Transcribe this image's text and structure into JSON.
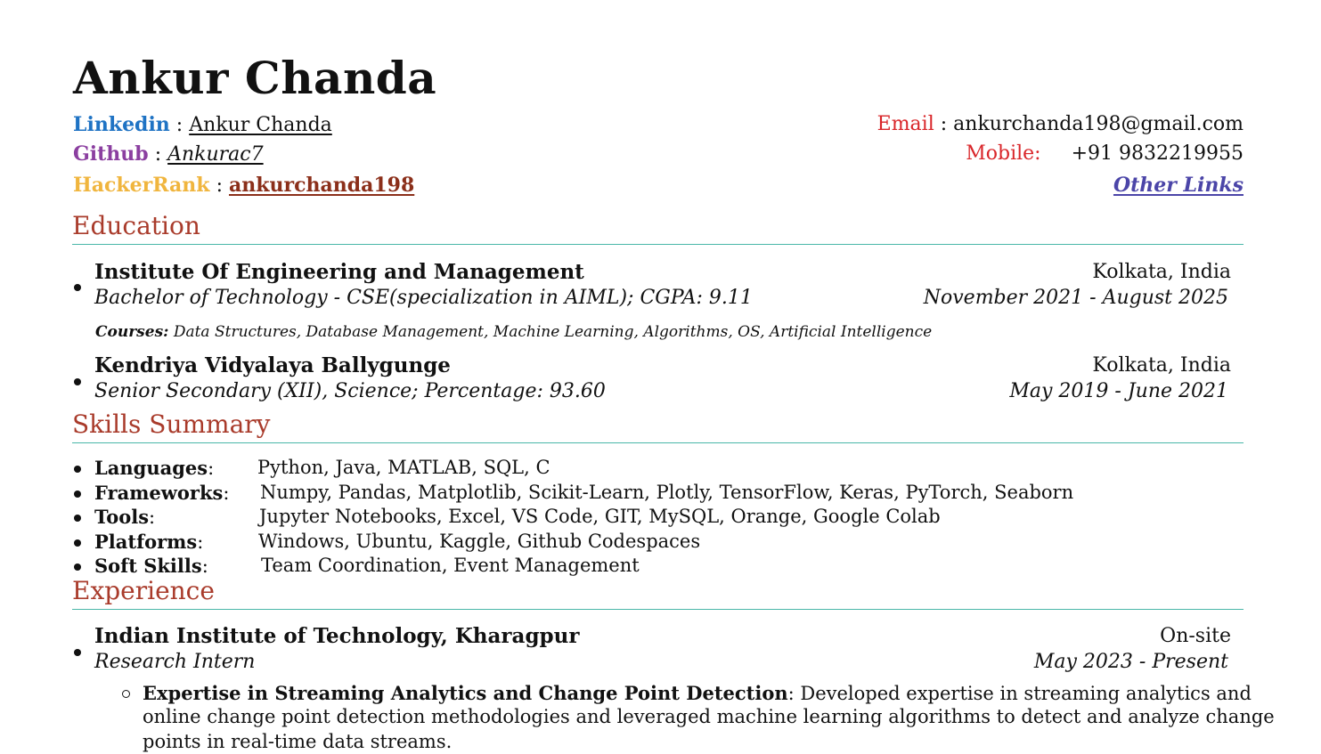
{
  "header": {
    "name": "Ankur Chanda",
    "linkedin_label": "Linkedin",
    "linkedin_value": "Ankur Chanda",
    "github_label": "Github",
    "github_value": "Ankurac7",
    "hackerrank_label": "HackerRank",
    "hackerrank_value": "ankurchanda198",
    "email_label": "Email",
    "email_value": "ankurchanda198@gmail.com",
    "mobile_label": "Mobile:",
    "mobile_value": "+91 9832219955",
    "other_links": "Other Links",
    "sep": ":"
  },
  "education": {
    "title": "Education",
    "entries": [
      {
        "school": "Institute Of Engineering and Management",
        "location": "Kolkata, India",
        "degree": "Bachelor of Technology - CSE(specialization in AIML); CGPA: 9.11",
        "dates": "November 2021 - August 2025",
        "courses_label": "Courses:",
        "courses": "Data Structures, Database Management, Machine Learning, Algorithms, OS, Artificial Intelligence"
      },
      {
        "school": "Kendriya Vidyalaya Ballygunge",
        "location": "Kolkata, India",
        "degree": "Senior Secondary (XII), Science; Percentage: 93.60",
        "dates": "May 2019 - June 2021"
      }
    ]
  },
  "skills": {
    "title": "Skills Summary",
    "items": [
      {
        "label": "Languages",
        "value": "Python, Java, MATLAB, SQL, C"
      },
      {
        "label": "Frameworks",
        "value": "Numpy, Pandas, Matplotlib, Scikit-Learn, Plotly, TensorFlow, Keras, PyTorch, Seaborn"
      },
      {
        "label": "Tools",
        "value": "Jupyter Notebooks, Excel, VS Code, GIT, MySQL, Orange, Google Colab"
      },
      {
        "label": "Platforms",
        "value": "Windows, Ubuntu, Kaggle, Github Codespaces"
      },
      {
        "label": "Soft Skills",
        "value": "Team Coordination, Event Management"
      }
    ],
    "colon": ":"
  },
  "experience": {
    "title": "Experience",
    "entries": [
      {
        "org": "Indian Institute of Technology, Kharagpur",
        "mode": "On-site",
        "role": "Research Intern",
        "dates": "May 2023 - Present",
        "points": [
          {
            "title": "Expertise in Streaming Analytics and Change Point Detection",
            "line1": ": Developed expertise in streaming analytics and",
            "line2": "online change point detection methodologies and leveraged machine learning algorithms to detect and analyze change",
            "line3": "points in real-time data streams."
          }
        ]
      }
    ]
  }
}
